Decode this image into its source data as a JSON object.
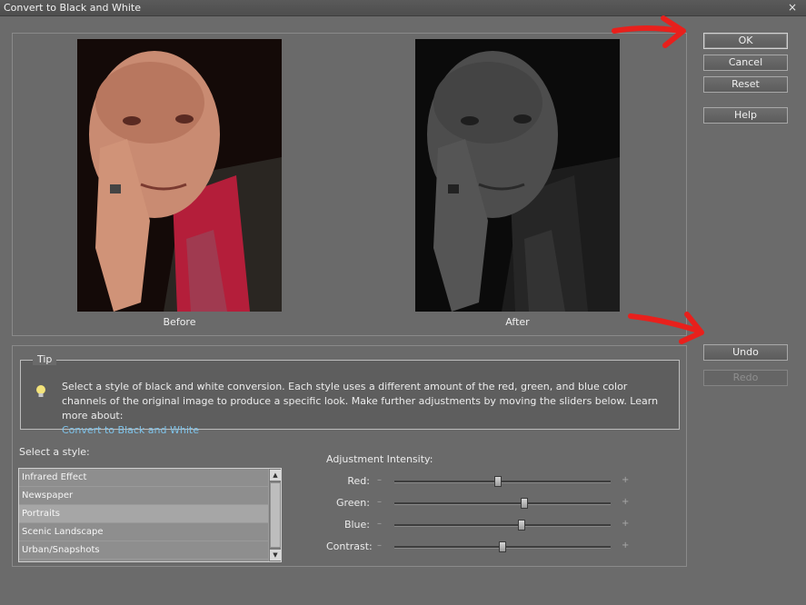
{
  "window": {
    "title": "Convert to Black and White",
    "close_glyph": "×"
  },
  "preview": {
    "before_label": "Before",
    "after_label": "After"
  },
  "buttons": {
    "ok": "OK",
    "cancel": "Cancel",
    "reset": "Reset",
    "help": "Help",
    "undo": "Undo",
    "redo": "Redo"
  },
  "tip": {
    "legend": "Tip",
    "icon": "lightbulb-icon",
    "text": "Select a style of black and white conversion. Each style uses a different amount of the red, green, and blue color channels of the original image to produce a specific look. Make further adjustments by moving the sliders below. Learn more about:",
    "link": "Convert to Black and White"
  },
  "styles": {
    "label": "Select a style:",
    "items": [
      "Infrared Effect",
      "Newspaper",
      "Portraits",
      "Scenic Landscape",
      "Urban/Snapshots"
    ],
    "selected": "Portraits"
  },
  "adjustment": {
    "label": "Adjustment Intensity:",
    "minus": "–",
    "plus": "+",
    "sliders": [
      {
        "label": "Red:",
        "value": 0.48
      },
      {
        "label": "Green:",
        "value": 0.6
      },
      {
        "label": "Blue:",
        "value": 0.59
      },
      {
        "label": "Contrast:",
        "value": 0.5
      }
    ]
  },
  "annotations": {
    "arrow_color": "#e8201c"
  }
}
